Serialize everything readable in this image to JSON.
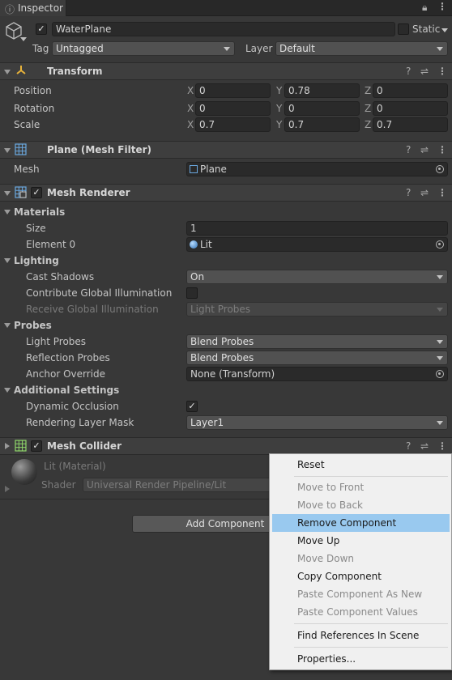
{
  "tab": {
    "title": "Inspector"
  },
  "object": {
    "name": "WaterPlane",
    "static_label": "Static",
    "tag_label": "Tag",
    "tag_value": "Untagged",
    "layer_label": "Layer",
    "layer_value": "Default"
  },
  "transform": {
    "title": "Transform",
    "rows": [
      {
        "label": "Position",
        "x": "0",
        "y": "0.78",
        "z": "0"
      },
      {
        "label": "Rotation",
        "x": "0",
        "y": "0",
        "z": "0"
      },
      {
        "label": "Scale",
        "x": "0.7",
        "y": "0.7",
        "z": "0.7"
      }
    ],
    "axis_x": "X",
    "axis_y": "Y",
    "axis_z": "Z"
  },
  "mesh_filter": {
    "title": "Plane (Mesh Filter)",
    "mesh_label": "Mesh",
    "mesh_value": "Plane"
  },
  "mesh_renderer": {
    "title": "Mesh Renderer",
    "materials": "Materials",
    "size_label": "Size",
    "size_value": "1",
    "element0_label": "Element 0",
    "element0_value": "Lit",
    "lighting": "Lighting",
    "cast_shadows_label": "Cast Shadows",
    "cast_shadows_value": "On",
    "contribute_gi_label": "Contribute Global Illumination",
    "receive_gi_label": "Receive Global Illumination",
    "receive_gi_value": "Light Probes",
    "probes": "Probes",
    "light_probes_label": "Light Probes",
    "light_probes_value": "Blend Probes",
    "reflection_probes_label": "Reflection Probes",
    "reflection_probes_value": "Blend Probes",
    "anchor_label": "Anchor Override",
    "anchor_value": "None (Transform)",
    "additional": "Additional Settings",
    "dynamic_occlusion_label": "Dynamic Occlusion",
    "rendering_layer_label": "Rendering Layer Mask",
    "rendering_layer_value": "Layer1"
  },
  "mesh_collider": {
    "title": "Mesh Collider"
  },
  "material": {
    "name": "Lit (Material)",
    "shader_label": "Shader",
    "shader_value": "Universal Render Pipeline/Lit"
  },
  "add_component": "Add Component",
  "context_menu": {
    "items": [
      {
        "label": "Reset",
        "enabled": true
      },
      {
        "label": "Move to Front",
        "enabled": false
      },
      {
        "label": "Move to Back",
        "enabled": false
      },
      {
        "label": "Remove Component",
        "enabled": true,
        "highlighted": true
      },
      {
        "label": "Move Up",
        "enabled": true
      },
      {
        "label": "Move Down",
        "enabled": false
      },
      {
        "label": "Copy Component",
        "enabled": true
      },
      {
        "label": "Paste Component As New",
        "enabled": false
      },
      {
        "label": "Paste Component Values",
        "enabled": false
      },
      {
        "label": "Find References In Scene",
        "enabled": true
      },
      {
        "label": "Properties...",
        "enabled": true
      }
    ]
  }
}
